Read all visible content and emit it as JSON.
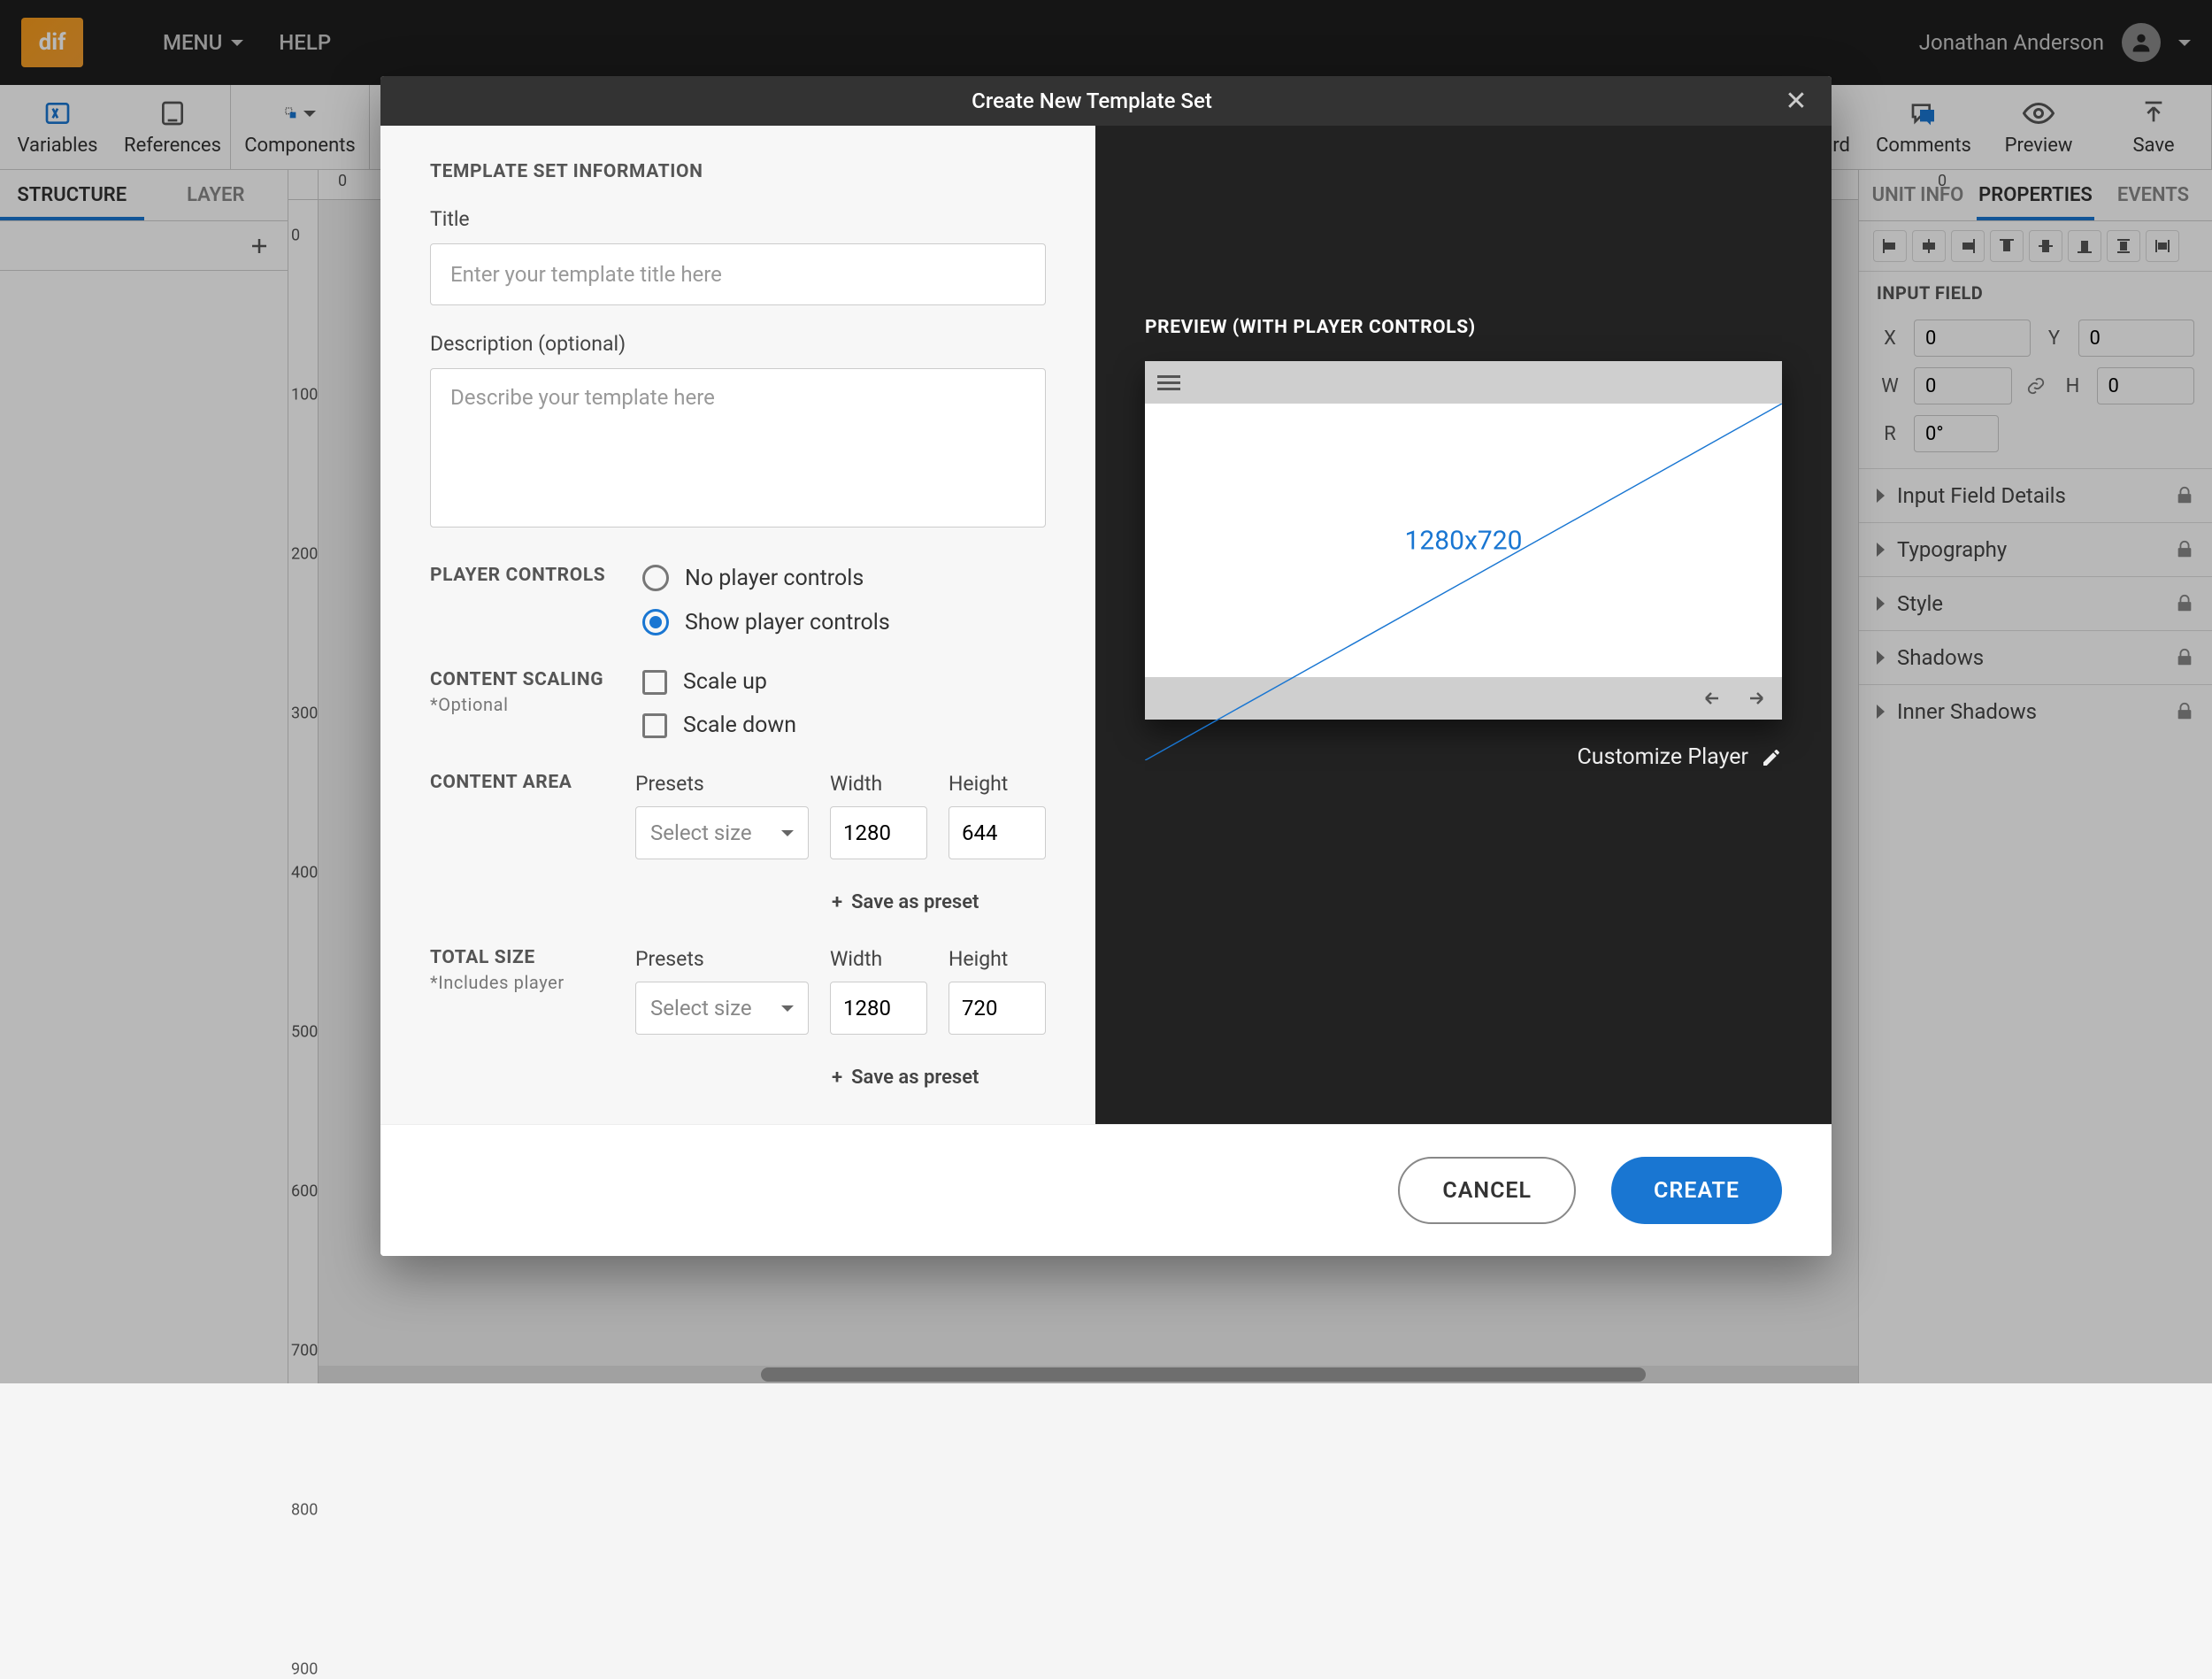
{
  "header": {
    "logo_text": "dif",
    "menu_label": "MENU",
    "help_label": "HELP",
    "username": "Jonathan Anderson"
  },
  "toolbar": {
    "variables": "Variables",
    "references": "References",
    "components": "Components",
    "clipboard": "Clipboard",
    "comments": "Comments",
    "preview": "Preview",
    "save": "Save"
  },
  "left_panel": {
    "tabs": {
      "structure": "STRUCTURE",
      "layer": "LAYER"
    }
  },
  "ruler": {
    "h": [
      "0",
      "100",
      "200",
      "300",
      "400",
      "500",
      "600",
      "700",
      "800",
      "900"
    ],
    "v": [
      "0",
      "100",
      "200",
      "300",
      "400",
      "500",
      "600",
      "700",
      "800",
      "900"
    ]
  },
  "right_panel": {
    "tabs": {
      "unit_info": "UNIT INFO",
      "properties": "PROPERTIES",
      "events": "EVENTS"
    },
    "section": "INPUT FIELD",
    "props": {
      "x_label": "X",
      "x_val": "0",
      "y_label": "Y",
      "y_val": "0",
      "w_label": "W",
      "w_val": "0",
      "h_label": "H",
      "h_val": "0",
      "r_label": "R",
      "r_val": "0°"
    },
    "accordions": [
      "Input Field Details",
      "Typography",
      "Style",
      "Shadows",
      "Inner Shadows"
    ]
  },
  "modal": {
    "title": "Create New Template Set",
    "section_info": "TEMPLATE SET INFORMATION",
    "title_label": "Title",
    "title_placeholder": "Enter your template title here",
    "desc_label": "Description (optional)",
    "desc_placeholder": "Describe your template here",
    "player_controls_label": "PLAYER CONTROLS",
    "radio_no": "No player controls",
    "radio_show": "Show player controls",
    "content_scaling_label": "CONTENT SCALING",
    "content_scaling_sub": "*Optional",
    "check_up": "Scale up",
    "check_down": "Scale down",
    "content_area_label": "CONTENT AREA",
    "total_size_label": "TOTAL SIZE",
    "total_size_sub": "*Includes player",
    "presets_label": "Presets",
    "select_size": "Select size",
    "width_label": "Width",
    "height_label": "Height",
    "content_width": "1280",
    "content_height": "644",
    "total_width": "1280",
    "total_height": "720",
    "save_preset": "Save as preset",
    "preview_label": "PREVIEW (WITH PLAYER CONTROLS)",
    "preview_dims": "1280x720",
    "customize_player": "Customize Player",
    "cancel": "CANCEL",
    "create": "CREATE"
  }
}
